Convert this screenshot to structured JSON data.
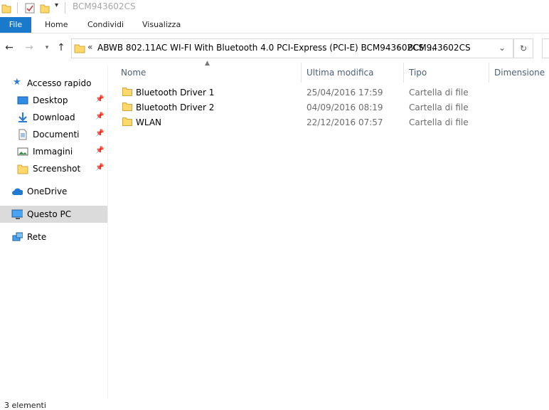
{
  "window": {
    "title": "BCM943602CS"
  },
  "ribbon": {
    "tabs": [
      {
        "label": "File"
      },
      {
        "label": "Home"
      },
      {
        "label": "Condividi"
      },
      {
        "label": "Visualizza"
      }
    ]
  },
  "address": {
    "overflow": "«",
    "parent": "ABWB 802.11AC WI-FI With Bluetooth 4.0 PCI-Express (PCI-E) BCM943602CS ...",
    "separator": "›",
    "current": "BCM943602CS"
  },
  "sidebar": {
    "items": [
      {
        "label": "Accesso rapido",
        "icon": "star-icon"
      },
      {
        "label": "Desktop",
        "icon": "desktop-icon",
        "pinned": true
      },
      {
        "label": "Download",
        "icon": "download-icon",
        "pinned": true
      },
      {
        "label": "Documenti",
        "icon": "documents-icon",
        "pinned": true
      },
      {
        "label": "Immagini",
        "icon": "pictures-icon",
        "pinned": true
      },
      {
        "label": "Screenshot",
        "icon": "folder-icon",
        "pinned": true
      },
      {
        "label": "OneDrive",
        "icon": "cloud-icon"
      },
      {
        "label": "Questo PC",
        "icon": "computer-icon",
        "selected": true
      },
      {
        "label": "Rete",
        "icon": "network-icon"
      }
    ]
  },
  "columns": {
    "name": "Nome",
    "modified": "Ultima modifica",
    "type": "Tipo",
    "size": "Dimensione"
  },
  "files": [
    {
      "name": "Bluetooth Driver 1",
      "modified": "25/04/2016 17:59",
      "type": "Cartella di file"
    },
    {
      "name": "Bluetooth Driver 2",
      "modified": "04/09/2016 08:19",
      "type": "Cartella di file"
    },
    {
      "name": "WLAN",
      "modified": "22/12/2016 07:57",
      "type": "Cartella di file"
    }
  ],
  "status": {
    "count_text": "3 elementi"
  },
  "colors": {
    "accent": "#1979ca",
    "folder": "#ffd86b",
    "selected": "#dbdbdb"
  }
}
